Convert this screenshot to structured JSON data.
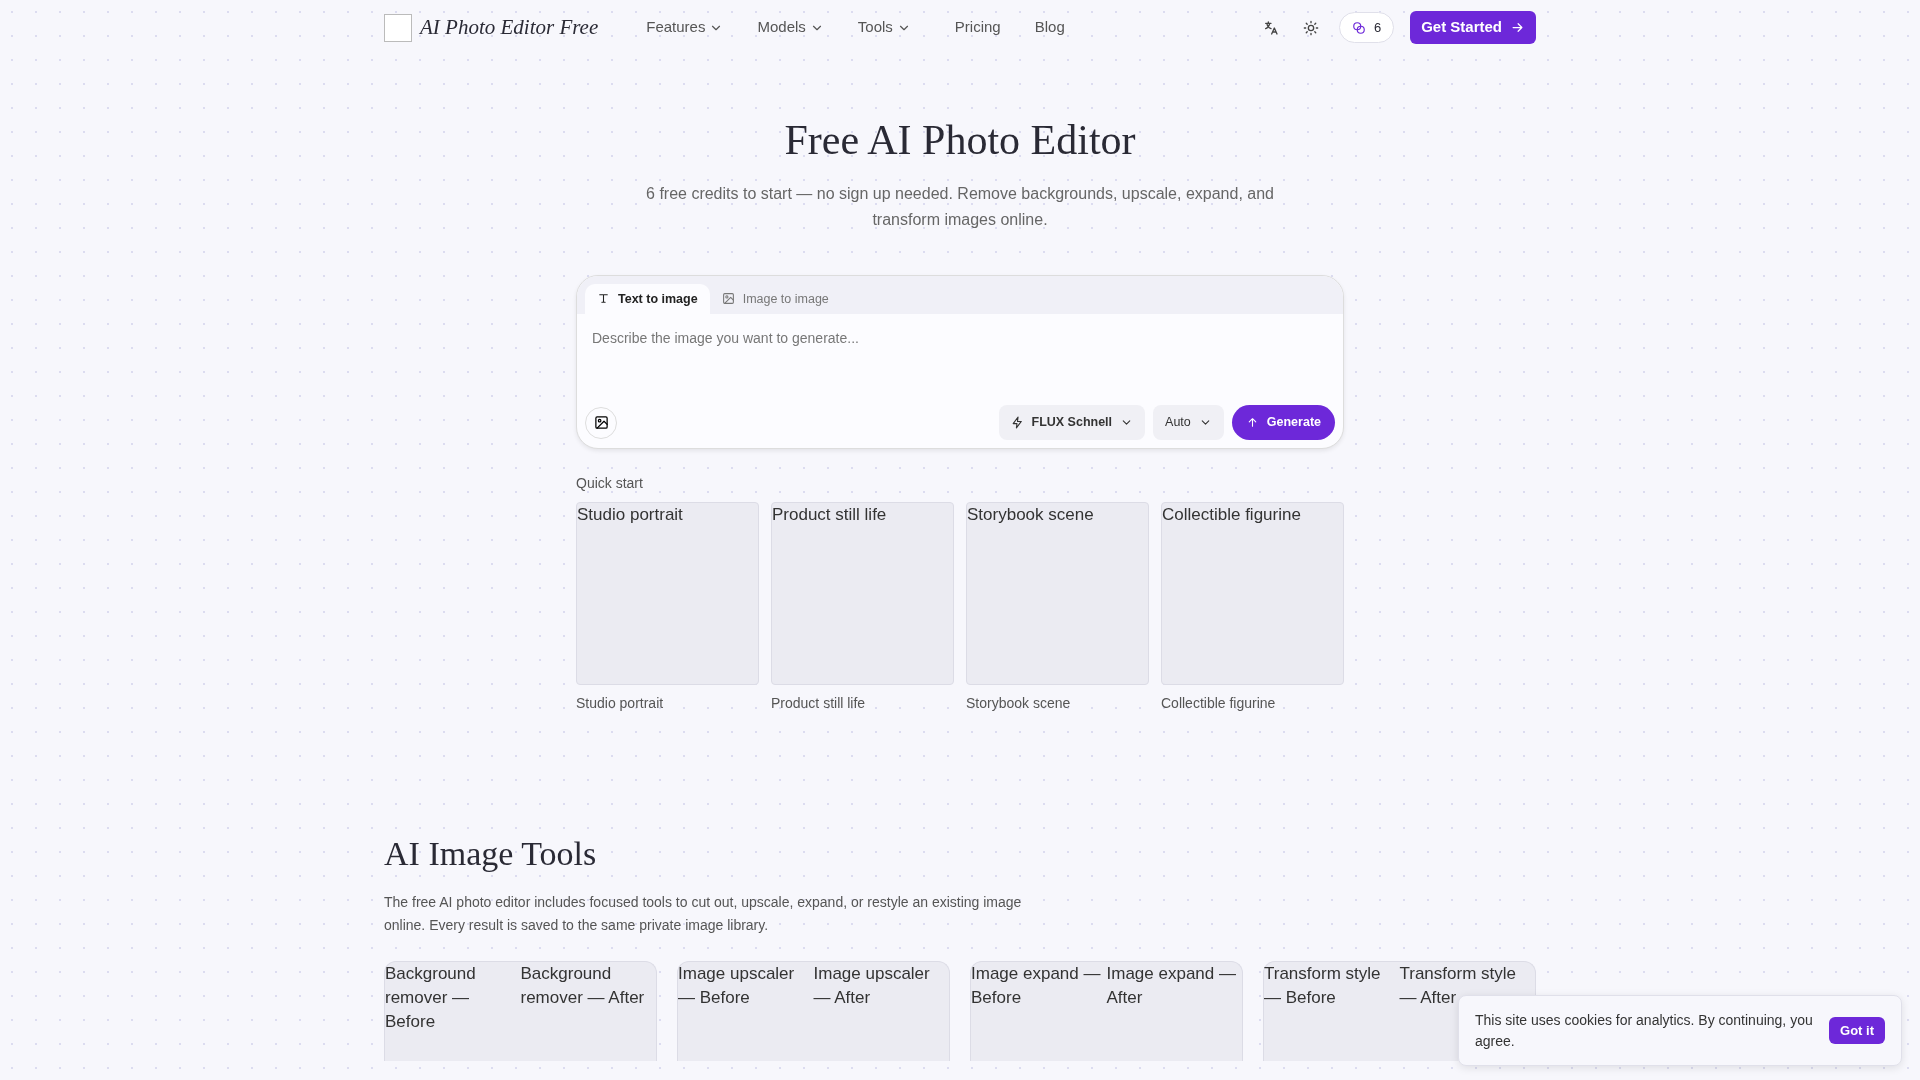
{
  "nav": {
    "logo_text": "AI Photo Editor Free",
    "links": [
      {
        "label": "Features",
        "dropdown": true
      },
      {
        "label": "Models",
        "dropdown": true
      },
      {
        "label": "Tools",
        "dropdown": true
      },
      {
        "label": "Pricing",
        "dropdown": false
      },
      {
        "label": "Blog",
        "dropdown": false
      }
    ],
    "credits": "6",
    "cta": "Get Started"
  },
  "hero": {
    "title": "Free AI Photo Editor",
    "subtitle": "6 free credits to start — no sign up needed. Remove backgrounds, upscale, expand, and transform images online."
  },
  "editor": {
    "tabs": [
      {
        "label": "Text to image",
        "kind": "text",
        "selected": true
      },
      {
        "label": "Image to image",
        "kind": "image",
        "selected": false
      }
    ],
    "placeholder": "Describe the image you want to generate...",
    "model": "FLUX Schnell",
    "ratio": "Auto",
    "generate": "Generate"
  },
  "quick_start": {
    "heading": "Quick start",
    "items": [
      {
        "alt": "Studio portrait",
        "caption": "Studio portrait"
      },
      {
        "alt": "Product still life",
        "caption": "Product still life"
      },
      {
        "alt": "Storybook scene",
        "caption": "Storybook scene"
      },
      {
        "alt": "Collectible figurine",
        "caption": "Collectible figurine"
      }
    ]
  },
  "tools": {
    "title": "AI Image Tools",
    "description": "The free AI photo editor includes focused tools to cut out, upscale, expand, or restyle an existing image online. Every result is saved to the same private image library.",
    "cards": [
      {
        "before_alt": "Background remover — Before",
        "after_alt": "Background remover — After"
      },
      {
        "before_alt": "Image upscaler — Before",
        "after_alt": "Image upscaler — After"
      },
      {
        "before_alt": "Image expand — Before",
        "after_alt": "Image expand — After"
      },
      {
        "before_alt": "Transform style — Before",
        "after_alt": "Transform style — After"
      }
    ]
  },
  "cookie": {
    "text": "This site uses cookies for analytics. By continuing, you agree.",
    "button": "Got it"
  }
}
